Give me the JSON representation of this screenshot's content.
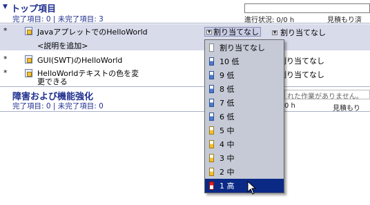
{
  "top_section": {
    "title": "トップ項目",
    "counts": "完了項目: 0 | 未完了項目: 3",
    "progress": "進行状況: 0/0 h",
    "estimate": "見積もり済"
  },
  "tasks": [
    {
      "mark": "*",
      "title": "JavaアプレットでのHelloWorld",
      "assign": "割り当てなし",
      "assign2": "割り当てなし"
    },
    {
      "mark": "",
      "title": "<説明を追加>",
      "assign": "",
      "assign2": ""
    },
    {
      "mark": "*",
      "title": "GUI(SWT)のHelloWorld",
      "assign": "",
      "assign2": "割り当てなし"
    },
    {
      "mark": "*",
      "title_line1": "HelloWorldテキストの色を変",
      "title_line2": "更できる",
      "assign": "",
      "assign2": "割り当てなし"
    }
  ],
  "bug_section": {
    "title": "障害および機能強化",
    "counts": "完了項目: 0 | 未完了項目: 0",
    "empty_msg": "れた作業がありません。",
    "progress": "0 h",
    "estimate": "見積もり"
  },
  "priority_menu": {
    "items": [
      {
        "label": "割り当てなし",
        "level": "none"
      },
      {
        "label": "10 低",
        "level": "low"
      },
      {
        "label": "9 低",
        "level": "low"
      },
      {
        "label": "8 低",
        "level": "low"
      },
      {
        "label": "7 低",
        "level": "low"
      },
      {
        "label": "6 低",
        "level": "low"
      },
      {
        "label": "5 中",
        "level": "mid"
      },
      {
        "label": "4 中",
        "level": "mid"
      },
      {
        "label": "3 中",
        "level": "mid"
      },
      {
        "label": "2 中",
        "level": "mid"
      },
      {
        "label": "1 高",
        "level": "high"
      }
    ],
    "selected_index": 10
  },
  "colors": {
    "accent": "#1f2f8f",
    "selection": "#0a2a86",
    "row_highlight": "#d8dbea"
  }
}
